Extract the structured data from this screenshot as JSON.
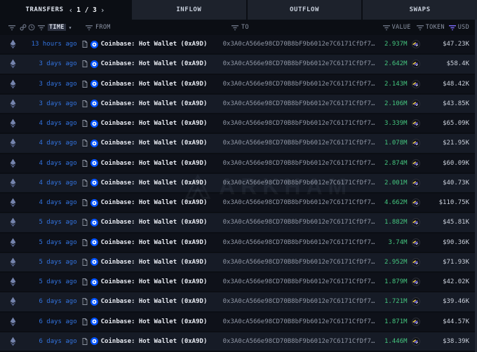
{
  "colors": {
    "accent_blue": "#3273df",
    "value_green": "#44c57e",
    "coinbase_blue": "#0052ff",
    "filter_purple": "#7d6bfa"
  },
  "tab_bar": {
    "transfers_label": "TRANSFERS",
    "pagination": {
      "prev": "‹",
      "label": "1 / 3",
      "next": "›"
    },
    "tabs": [
      {
        "label": "INFLOW"
      },
      {
        "label": "OUTFLOW"
      },
      {
        "label": "SWAPS"
      }
    ]
  },
  "table": {
    "headers": {
      "time": "TIME",
      "from": "FROM",
      "to": "TO",
      "value": "VALUE",
      "token": "TOKEN",
      "usd": "USD"
    },
    "sort_caret": "▾",
    "rows": [
      {
        "time": "13 hours ago",
        "from": "Coinbase: Hot Wallet (0xA9D)",
        "to": "0x3A0cA566e98CD70B8bF9b6012e7C6171CfDf7…",
        "value": "2.937M",
        "usd": "$47.23K"
      },
      {
        "time": "3 days ago",
        "from": "Coinbase: Hot Wallet (0xA9D)",
        "to": "0x3A0cA566e98CD70B8bF9b6012e7C6171CfDf7…",
        "value": "2.642M",
        "usd": "$58.4K"
      },
      {
        "time": "3 days ago",
        "from": "Coinbase: Hot Wallet (0xA9D)",
        "to": "0x3A0cA566e98CD70B8bF9b6012e7C6171CfDf7…",
        "value": "2.143M",
        "usd": "$48.42K"
      },
      {
        "time": "3 days ago",
        "from": "Coinbase: Hot Wallet (0xA9D)",
        "to": "0x3A0cA566e98CD70B8bF9b6012e7C6171CfDf7…",
        "value": "2.106M",
        "usd": "$43.85K"
      },
      {
        "time": "4 days ago",
        "from": "Coinbase: Hot Wallet (0xA9D)",
        "to": "0x3A0cA566e98CD70B8bF9b6012e7C6171CfDf7…",
        "value": "3.339M",
        "usd": "$65.09K"
      },
      {
        "time": "4 days ago",
        "from": "Coinbase: Hot Wallet (0xA9D)",
        "to": "0x3A0cA566e98CD70B8bF9b6012e7C6171CfDf7…",
        "value": "1.078M",
        "usd": "$21.95K"
      },
      {
        "time": "4 days ago",
        "from": "Coinbase: Hot Wallet (0xA9D)",
        "to": "0x3A0cA566e98CD70B8bF9b6012e7C6171CfDf7…",
        "value": "2.874M",
        "usd": "$60.09K"
      },
      {
        "time": "4 days ago",
        "from": "Coinbase: Hot Wallet (0xA9D)",
        "to": "0x3A0cA566e98CD70B8bF9b6012e7C6171CfDf7…",
        "value": "2.001M",
        "usd": "$40.73K"
      },
      {
        "time": "4 days ago",
        "from": "Coinbase: Hot Wallet (0xA9D)",
        "to": "0x3A0cA566e98CD70B8bF9b6012e7C6171CfDf7…",
        "value": "4.662M",
        "usd": "$110.75K"
      },
      {
        "time": "5 days ago",
        "from": "Coinbase: Hot Wallet (0xA9D)",
        "to": "0x3A0cA566e98CD70B8bF9b6012e7C6171CfDf7…",
        "value": "1.882M",
        "usd": "$45.81K"
      },
      {
        "time": "5 days ago",
        "from": "Coinbase: Hot Wallet (0xA9D)",
        "to": "0x3A0cA566e98CD70B8bF9b6012e7C6171CfDf7…",
        "value": "3.74M",
        "usd": "$90.36K"
      },
      {
        "time": "5 days ago",
        "from": "Coinbase: Hot Wallet (0xA9D)",
        "to": "0x3A0cA566e98CD70B8bF9b6012e7C6171CfDf7…",
        "value": "2.952M",
        "usd": "$71.93K"
      },
      {
        "time": "5 days ago",
        "from": "Coinbase: Hot Wallet (0xA9D)",
        "to": "0x3A0cA566e98CD70B8bF9b6012e7C6171CfDf7…",
        "value": "1.879M",
        "usd": "$42.02K"
      },
      {
        "time": "6 days ago",
        "from": "Coinbase: Hot Wallet (0xA9D)",
        "to": "0x3A0cA566e98CD70B8bF9b6012e7C6171CfDf7…",
        "value": "1.721M",
        "usd": "$39.46K"
      },
      {
        "time": "6 days ago",
        "from": "Coinbase: Hot Wallet (0xA9D)",
        "to": "0x3A0cA566e98CD70B8bF9b6012e7C6171CfDf7…",
        "value": "1.871M",
        "usd": "$44.57K"
      },
      {
        "time": "6 days ago",
        "from": "Coinbase: Hot Wallet (0xA9D)",
        "to": "0x3A0cA566e98CD70B8bF9b6012e7C6171CfDf7…",
        "value": "1.446M",
        "usd": "$38.39K"
      }
    ]
  },
  "watermark": {
    "text": "ARKHAM"
  }
}
